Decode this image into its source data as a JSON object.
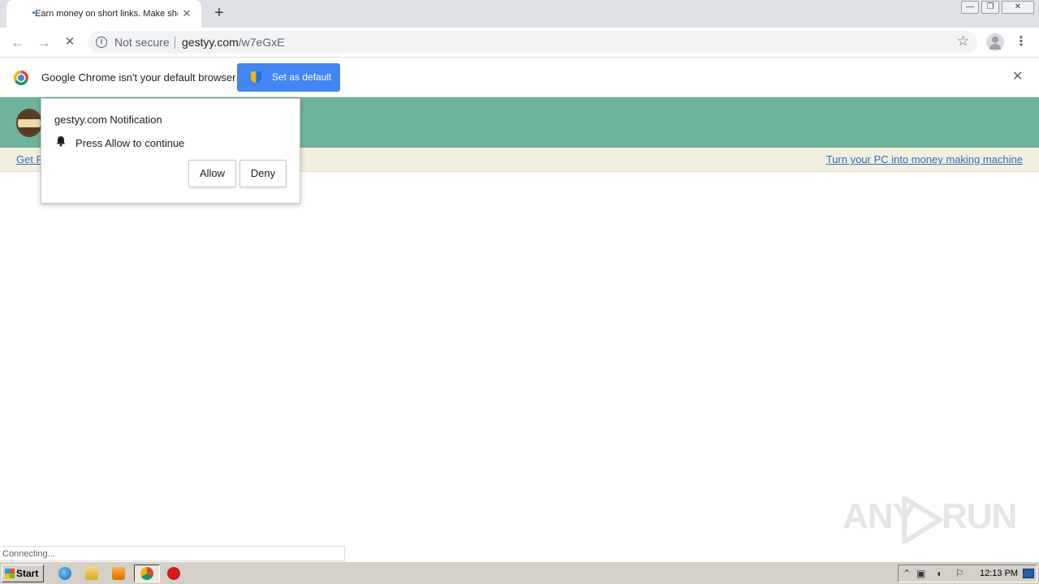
{
  "browser": {
    "tab": {
      "title": "Earn money on short links. Make sho",
      "close_glyph": "✕"
    },
    "new_tab_glyph": "+",
    "window_controls": [
      "—",
      "❐",
      "✕"
    ],
    "nav": {
      "back_glyph": "←",
      "forward_glyph": "→",
      "reload_glyph": "✕"
    },
    "omnibox": {
      "security_label": "Not secure",
      "url_host": "gestyy.com",
      "url_path": "/w7eGxE"
    },
    "star_glyph": "☆",
    "menu_glyph": "⋮"
  },
  "infobar": {
    "message": "Google Chrome isn't your default browser",
    "button_label": "Set as default",
    "close_glyph": "✕"
  },
  "page": {
    "link_left": "Get R",
    "link_right": "Turn your PC into money making machine"
  },
  "permission_popup": {
    "title": "gestyy.com Notification",
    "message": "Press Allow to continue",
    "allow_label": "Allow",
    "deny_label": "Deny"
  },
  "status_text": "Connecting...",
  "watermark": {
    "left": "ANY",
    "right": "RUN"
  },
  "taskbar": {
    "start_label": "Start",
    "clock": "12:13 PM"
  },
  "colors": {
    "header_green": "#6db59a",
    "link_blue": "#2a6fbf",
    "button_blue": "#4285f4"
  }
}
